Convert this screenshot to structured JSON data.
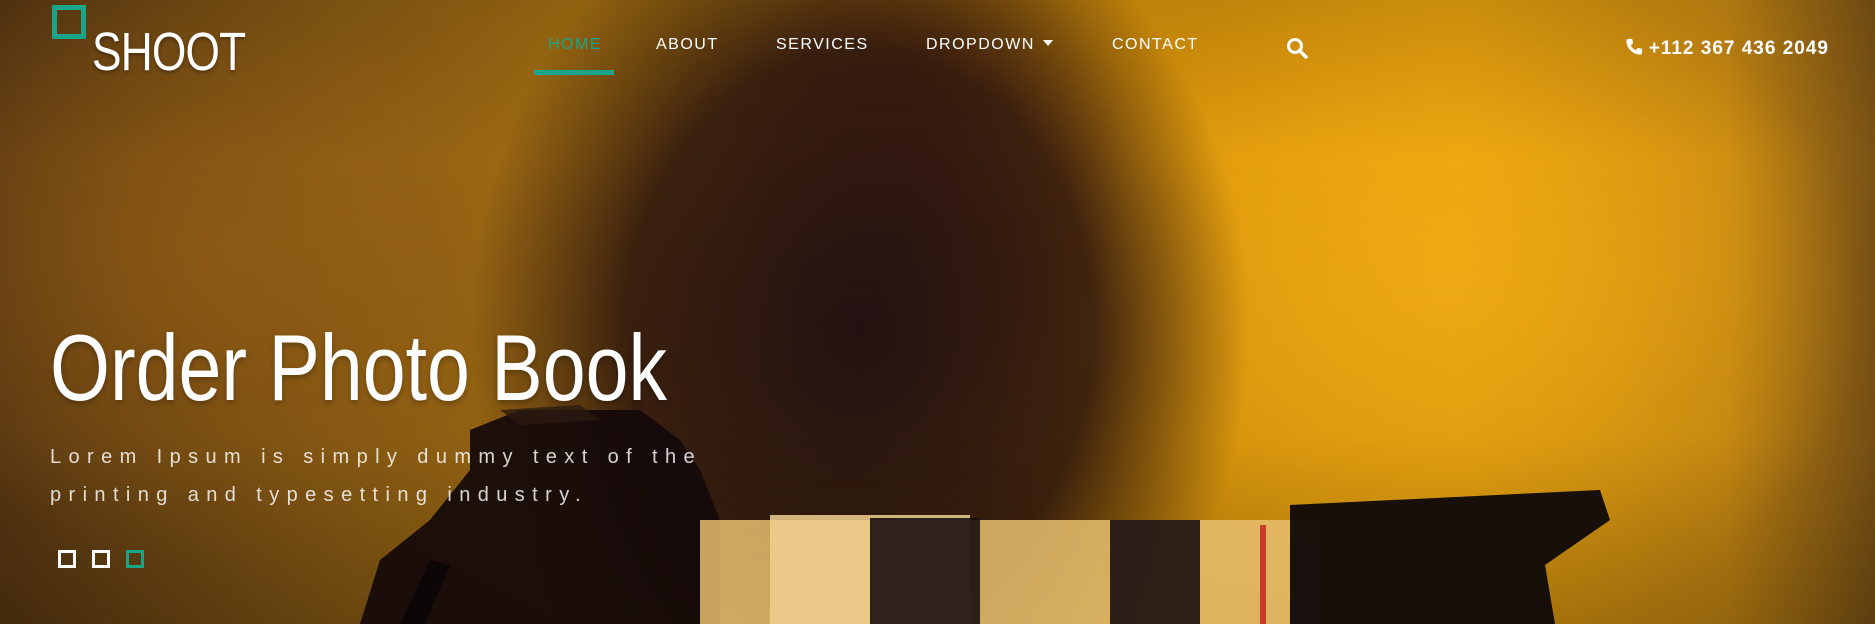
{
  "brand": {
    "name": "SHOOT",
    "accent_color": "#1aa58a"
  },
  "nav": {
    "items": [
      {
        "label": "HOME",
        "active": true
      },
      {
        "label": "ABOUT",
        "active": false
      },
      {
        "label": "SERVICES",
        "active": false
      },
      {
        "label": "DROPDOWN",
        "active": false,
        "has_caret": true
      },
      {
        "label": "CONTACT",
        "active": false
      }
    ],
    "search_icon": "search-icon"
  },
  "contact": {
    "phone": "+112 367 436 2049",
    "icon": "phone-icon"
  },
  "hero": {
    "title": "Order Photo Book",
    "subtitle": "Lorem Ipsum is simply dummy text of the printing and typesetting industry.",
    "slides": [
      {
        "active": false
      },
      {
        "active": false
      },
      {
        "active": true
      }
    ]
  }
}
